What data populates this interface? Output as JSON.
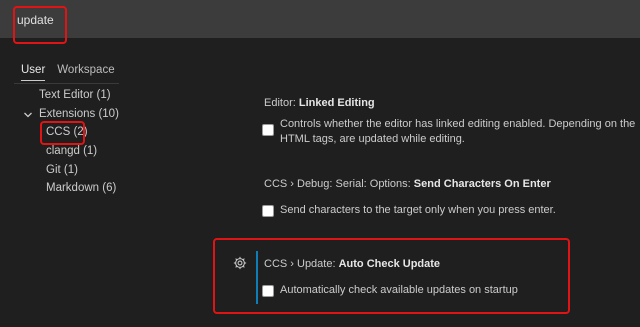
{
  "search": {
    "value": "update"
  },
  "tabs": [
    {
      "label": "User"
    },
    {
      "label": "Workspace"
    }
  ],
  "tree": [
    {
      "label": "Text Editor (1)"
    },
    {
      "label": "Extensions (10)"
    },
    {
      "label": "CCS (2)"
    },
    {
      "label": "clangd (1)"
    },
    {
      "label": "Git (1)"
    },
    {
      "label": "Markdown (6)"
    }
  ],
  "settings": [
    {
      "category": "Editor: ",
      "name": "Linked Editing",
      "description_lines": [
        "Controls whether the editor has linked editing enabled. Depending on the",
        "HTML tags, are updated while editing."
      ]
    },
    {
      "category": "CCS › Debug: Serial: Options: ",
      "name": "Send Characters On Enter",
      "description_lines": [
        "Send characters to the target only when you press enter."
      ]
    },
    {
      "category": "CCS › Update: ",
      "name": "Auto Check Update",
      "description_lines": [
        "Automatically check available updates on startup"
      ]
    }
  ],
  "colors": {
    "highlight": "#e01414",
    "focus_bar": "#0e7db8"
  },
  "icons": {
    "settings_gear": "gear-icon",
    "tree_expander": "chevron-down-icon"
  }
}
